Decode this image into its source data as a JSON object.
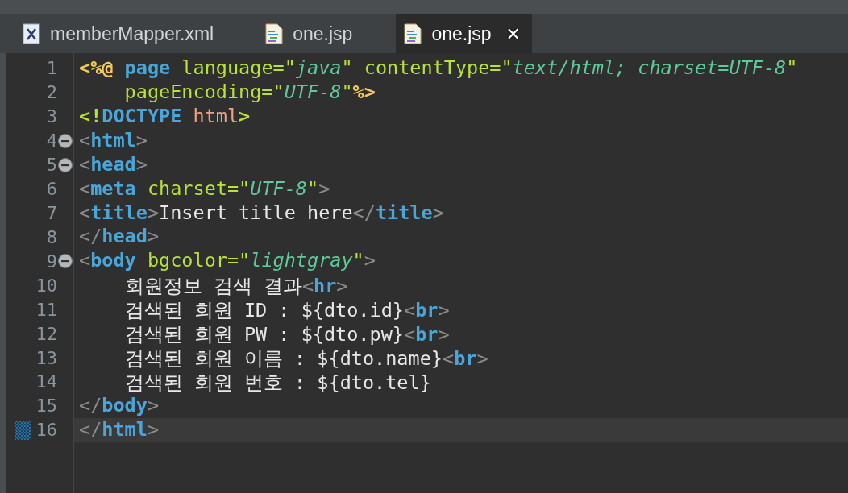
{
  "tabs": [
    {
      "label": "memberMapper.xml",
      "kind": "xml",
      "selected": false,
      "closable": false
    },
    {
      "label": "one.jsp",
      "kind": "jsp",
      "selected": false,
      "closable": false
    },
    {
      "label": "one.jsp",
      "kind": "jsp",
      "selected": true,
      "closable": true
    }
  ],
  "close_glyph": "✕",
  "lines": [
    {
      "number": "1",
      "fold": false,
      "current": false,
      "tokens": [
        {
          "kind": "directive",
          "text": "<%@ "
        },
        {
          "kind": "tag",
          "text": "page "
        },
        {
          "kind": "attr",
          "text": "language="
        },
        {
          "kind": "quote",
          "text": "\""
        },
        {
          "kind": "value",
          "text": "java"
        },
        {
          "kind": "quote",
          "text": "\" "
        },
        {
          "kind": "attr",
          "text": "contentType="
        },
        {
          "kind": "quote",
          "text": "\""
        },
        {
          "kind": "value",
          "text": "text/html; charset=UTF-8"
        },
        {
          "kind": "quote",
          "text": "\""
        }
      ]
    },
    {
      "number": "2",
      "fold": false,
      "current": false,
      "tokens": [
        {
          "kind": "attr",
          "text": "    pageEncoding="
        },
        {
          "kind": "quote",
          "text": "\""
        },
        {
          "kind": "value",
          "text": "UTF-8"
        },
        {
          "kind": "quote",
          "text": "\""
        },
        {
          "kind": "directive",
          "text": "%>"
        }
      ]
    },
    {
      "number": "3",
      "fold": false,
      "current": false,
      "tokens": [
        {
          "kind": "keyword",
          "text": "<!"
        },
        {
          "kind": "tag",
          "text": "DOCTYPE "
        },
        {
          "kind": "name",
          "text": "html"
        },
        {
          "kind": "keyword",
          "text": ">"
        }
      ]
    },
    {
      "number": "4",
      "fold": true,
      "current": false,
      "tokens": [
        {
          "kind": "delim",
          "text": "<"
        },
        {
          "kind": "tag",
          "text": "html"
        },
        {
          "kind": "delim",
          "text": ">"
        }
      ]
    },
    {
      "number": "5",
      "fold": true,
      "current": false,
      "tokens": [
        {
          "kind": "delim",
          "text": "<"
        },
        {
          "kind": "tag",
          "text": "head"
        },
        {
          "kind": "delim",
          "text": ">"
        }
      ]
    },
    {
      "number": "6",
      "fold": false,
      "current": false,
      "tokens": [
        {
          "kind": "delim",
          "text": "<"
        },
        {
          "kind": "tag",
          "text": "meta "
        },
        {
          "kind": "attr",
          "text": "charset="
        },
        {
          "kind": "quote",
          "text": "\""
        },
        {
          "kind": "value",
          "text": "UTF-8"
        },
        {
          "kind": "quote",
          "text": "\""
        },
        {
          "kind": "delim",
          "text": ">"
        }
      ]
    },
    {
      "number": "7",
      "fold": false,
      "current": false,
      "tokens": [
        {
          "kind": "delim",
          "text": "<"
        },
        {
          "kind": "tag",
          "text": "title"
        },
        {
          "kind": "delim",
          "text": ">"
        },
        {
          "kind": "text",
          "text": "Insert title here"
        },
        {
          "kind": "delim",
          "text": "</"
        },
        {
          "kind": "tag",
          "text": "title"
        },
        {
          "kind": "delim",
          "text": ">"
        }
      ]
    },
    {
      "number": "8",
      "fold": false,
      "current": false,
      "tokens": [
        {
          "kind": "delim",
          "text": "</"
        },
        {
          "kind": "tag",
          "text": "head"
        },
        {
          "kind": "delim",
          "text": ">"
        }
      ]
    },
    {
      "number": "9",
      "fold": true,
      "current": false,
      "tokens": [
        {
          "kind": "delim",
          "text": "<"
        },
        {
          "kind": "tag",
          "text": "body "
        },
        {
          "kind": "attr",
          "text": "bgcolor="
        },
        {
          "kind": "quote",
          "text": "\""
        },
        {
          "kind": "value",
          "text": "lightgray"
        },
        {
          "kind": "quote",
          "text": "\""
        },
        {
          "kind": "delim",
          "text": ">"
        }
      ]
    },
    {
      "number": "10",
      "fold": false,
      "current": false,
      "tokens": [
        {
          "kind": "text",
          "text": "    회원정보 검색 결과"
        },
        {
          "kind": "delim",
          "text": "<"
        },
        {
          "kind": "tag",
          "text": "hr"
        },
        {
          "kind": "delim",
          "text": ">"
        }
      ]
    },
    {
      "number": "11",
      "fold": false,
      "current": false,
      "tokens": [
        {
          "kind": "text",
          "text": "    검색된 회원 ID : ${dto.id}"
        },
        {
          "kind": "delim",
          "text": "<"
        },
        {
          "kind": "tag",
          "text": "br"
        },
        {
          "kind": "delim",
          "text": ">"
        }
      ]
    },
    {
      "number": "12",
      "fold": false,
      "current": false,
      "tokens": [
        {
          "kind": "text",
          "text": "    검색된 회원 PW : ${dto.pw}"
        },
        {
          "kind": "delim",
          "text": "<"
        },
        {
          "kind": "tag",
          "text": "br"
        },
        {
          "kind": "delim",
          "text": ">"
        }
      ]
    },
    {
      "number": "13",
      "fold": false,
      "current": false,
      "tokens": [
        {
          "kind": "text",
          "text": "    검색된 회원 이름 : ${dto.name}"
        },
        {
          "kind": "delim",
          "text": "<"
        },
        {
          "kind": "tag",
          "text": "br"
        },
        {
          "kind": "delim",
          "text": ">"
        }
      ]
    },
    {
      "number": "14",
      "fold": false,
      "current": false,
      "tokens": [
        {
          "kind": "text",
          "text": "    검색된 회원 번호 : ${dto.tel}"
        }
      ]
    },
    {
      "number": "15",
      "fold": false,
      "current": false,
      "tokens": [
        {
          "kind": "delim",
          "text": "</"
        },
        {
          "kind": "tag",
          "text": "body"
        },
        {
          "kind": "delim",
          "text": ">"
        }
      ]
    },
    {
      "number": "16",
      "fold": false,
      "current": true,
      "tokens": [
        {
          "kind": "delim",
          "text": "</"
        },
        {
          "kind": "tag",
          "text": "html"
        },
        {
          "kind": "delim",
          "text": ">"
        }
      ]
    }
  ]
}
